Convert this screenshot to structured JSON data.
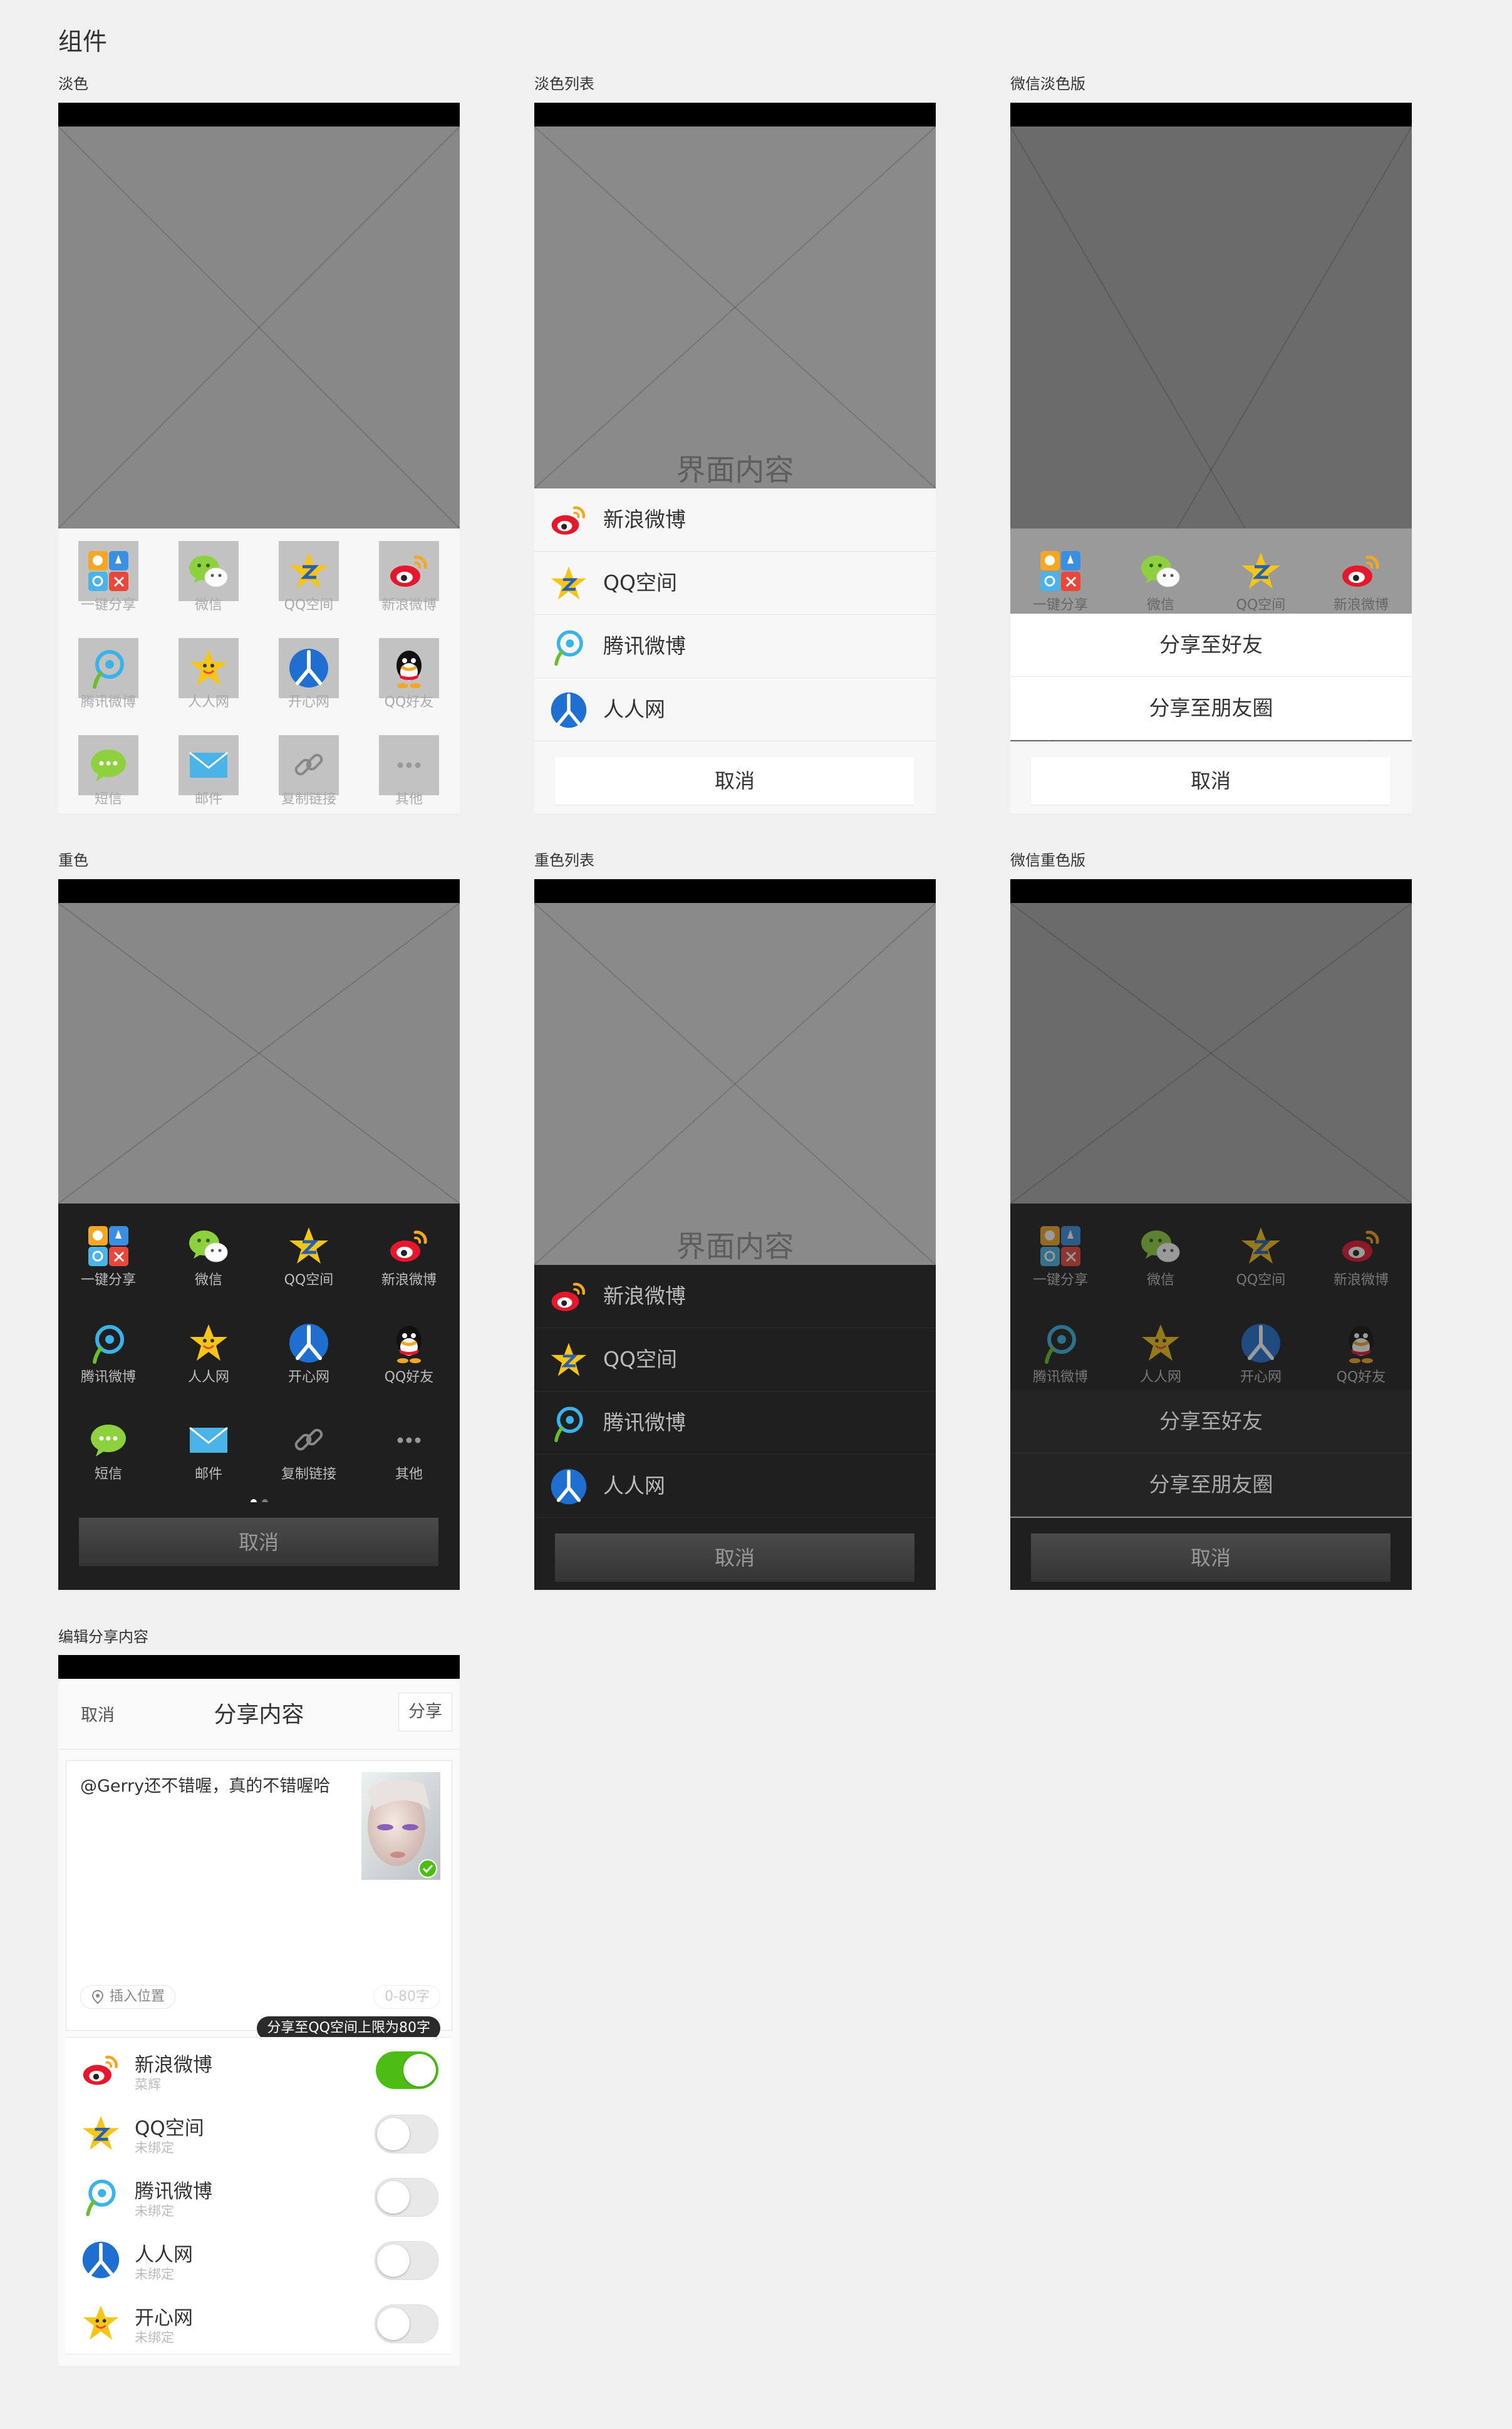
{
  "page_title": "组件",
  "sections": {
    "light": "淡色",
    "light_list": "淡色列表",
    "wechat_light": "微信淡色版",
    "dark": "重色",
    "dark_list": "重色列表",
    "wechat_dark": "微信重色版",
    "edit": "编辑分享内容"
  },
  "content_placeholder": "界面内容",
  "cancel": "取消",
  "grid": {
    "page1": [
      {
        "label": "一键分享",
        "icon": "one-key-share-icon"
      },
      {
        "label": "微信",
        "icon": "wechat-icon"
      },
      {
        "label": "QQ空间",
        "icon": "qzone-icon"
      },
      {
        "label": "新浪微博",
        "icon": "sina-weibo-icon"
      },
      {
        "label": "腾讯微博",
        "icon": "tencent-weibo-icon"
      },
      {
        "label": "人人网",
        "icon": "kaixin-icon"
      },
      {
        "label": "开心网",
        "icon": "renren-icon"
      },
      {
        "label": "QQ好友",
        "icon": "qq-icon"
      },
      {
        "label": "短信",
        "icon": "sms-icon"
      },
      {
        "label": "邮件",
        "icon": "mail-icon"
      },
      {
        "label": "复制链接",
        "icon": "link-icon"
      },
      {
        "label": "其他",
        "icon": "more-icon"
      }
    ]
  },
  "list": [
    {
      "label": "新浪微博",
      "icon": "sina-weibo-icon"
    },
    {
      "label": "QQ空间",
      "icon": "qzone-icon"
    },
    {
      "label": "腾讯微博",
      "icon": "tencent-weibo-icon"
    },
    {
      "label": "人人网",
      "icon": "renren-icon"
    }
  ],
  "wechat_options": [
    "分享至好友",
    "分享至朋友圈"
  ],
  "editor": {
    "cancel": "取消",
    "title": "分享内容",
    "share": "分享",
    "text": "@Gerry还不错喔，真的不错喔哈",
    "location": "插入位置",
    "count": "0-80字",
    "tip": "分享至QQ空间上限为80字",
    "platforms": [
      {
        "name": "新浪微博",
        "status": "菜辉",
        "on": true,
        "icon": "sina-weibo-icon"
      },
      {
        "name": "QQ空间",
        "status": "未绑定",
        "on": false,
        "icon": "qzone-icon"
      },
      {
        "name": "腾讯微博",
        "status": "未绑定",
        "on": false,
        "icon": "tencent-weibo-icon"
      },
      {
        "name": "人人网",
        "status": "未绑定",
        "on": false,
        "icon": "renren-icon"
      },
      {
        "name": "开心网",
        "status": "未绑定",
        "on": false,
        "icon": "kaixin-icon"
      }
    ]
  },
  "colors": {
    "toggle_on": "#4cbd15",
    "dark_sheet": "#1f1f1f",
    "light_sheet": "#f7f7f7"
  }
}
